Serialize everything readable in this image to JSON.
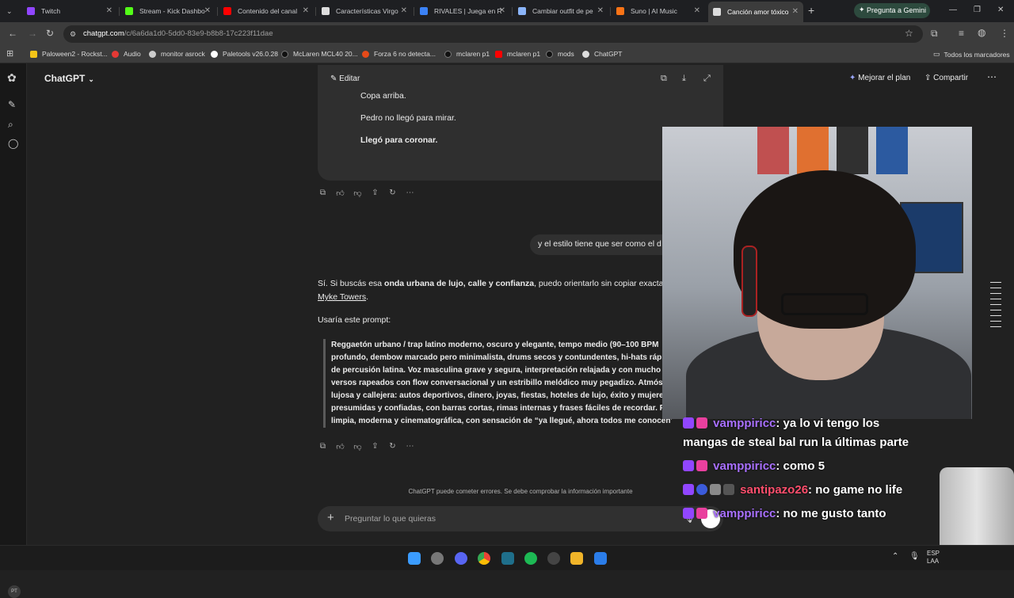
{
  "tabs": [
    {
      "label": "Twitch",
      "color": "#9146ff",
      "active": false
    },
    {
      "label": "Stream - Kick Dashbo",
      "color": "#53fc18",
      "active": false
    },
    {
      "label": "Contenido del canal",
      "color": "#ff0000",
      "active": false
    },
    {
      "label": "Características Virgo",
      "color": "#dddddd",
      "active": false
    },
    {
      "label": "RIVALES | Juega en R",
      "color": "#3b82f6",
      "active": false
    },
    {
      "label": "Cambiar outfit de pe",
      "color": "#8ab4f8",
      "active": false
    },
    {
      "label": "Suno | AI Music",
      "color": "#f97316",
      "active": false
    },
    {
      "label": "Canción amor tóxico",
      "color": "#dddddd",
      "active": true
    }
  ],
  "gemini_label": "Pregunta a Gemini",
  "url": {
    "host": "chatgpt.com",
    "path": "/c/6a6da1d0-5dd0-83e9-b8b8-17c223f11dae"
  },
  "bookmarks": [
    {
      "label": "Paloween2 - Rockst...",
      "color": "#f5c518"
    },
    {
      "label": "Audio",
      "color": "#e53935"
    },
    {
      "label": "monitor asrock",
      "color": "#cccccc"
    },
    {
      "label": "Paletools v26.0.28",
      "color": "#ffffff"
    },
    {
      "label": "McLaren MCL40 20...",
      "color": "#111111"
    },
    {
      "label": "Forza 6 no detecta...",
      "color": "#e64a19"
    },
    {
      "label": "mclaren p1",
      "color": "#111111"
    },
    {
      "label": "mclaren p1",
      "color": "#ff0000"
    },
    {
      "label": "mods",
      "color": "#111111"
    },
    {
      "label": "ChatGPT",
      "color": "#dddddd"
    }
  ],
  "all_bookmarks": "Todos los marcadores",
  "app": {
    "brand": "ChatGPT",
    "upgrade": "Mejorar el plan",
    "share": "Compartir",
    "edit": "Editar"
  },
  "card_lines": [
    {
      "text": "Copa arriba.",
      "bold": false
    },
    {
      "text": "Pedro no llegó para mirar.",
      "bold": false
    },
    {
      "text": "Llegó para coronar.",
      "bold": true
    }
  ],
  "user_message": "y el estilo tiene que ser como el d",
  "answer": {
    "p1_a": "Sí. Si buscás esa ",
    "p1_b": "onda urbana de lujo, calle y confianza",
    "p1_c": ", puedo orientarlo sin copiar exactam",
    "p1_link": "Myke Towers",
    "p2": "Usaría este prompt:",
    "quote": [
      "Reggaetón urbano / trap latino moderno, oscuro y elegante, tempo medio (90–100 BPM",
      "profundo, dembow marcado pero minimalista, drums secos y contundentes, hi-hats ráp",
      "de percusión latina. Voz masculina grave y segura, interpretación relajada y con mucho",
      "versos rapeados con flow conversacional y un estribillo melódico muy pegadizo. Atmós",
      "lujosa y callejera: autos deportivos, dinero, joyas, fiestas, hoteles de lujo, éxito y mujere",
      "presumidas y confiadas, con barras cortas, rimas internas y frases fáciles de recordar. P",
      "limpia, moderna y cinematográfica, con sensación de “ya llegué, ahora todos me conocen”."
    ]
  },
  "disclaimer": "ChatGPT puede cometer errores. Se debe comprobar la información importante",
  "composer_placeholder": "Preguntar lo que quieras",
  "avatar": "PT",
  "chat": [
    {
      "user": "vamppiricc",
      "text": ": ya lo vi tengo los"
    },
    {
      "user": "",
      "text": "mangas de steal bal run la últimas parte"
    },
    {
      "user": "vamppiricc",
      "text": ": como 5"
    },
    {
      "user": "santipazo26",
      "text": ": no game no life"
    },
    {
      "user": "vamppiricc",
      "text": ": no me gusto tanto"
    }
  ],
  "tray": {
    "lang": "ESP",
    "layout": "LAA"
  }
}
